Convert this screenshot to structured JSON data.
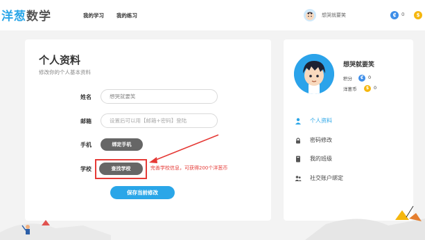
{
  "header": {
    "logo_part1": "洋葱",
    "logo_part2": "数学",
    "nav": [
      "我的学习",
      "我的练习"
    ],
    "username": "想哭就要笑",
    "coin1_value": "0"
  },
  "profile": {
    "title": "个人资料",
    "subtitle": "修改你的个人基本资料",
    "name_label": "姓名",
    "name_value": "想哭就要笑",
    "email_label": "邮箱",
    "email_placeholder": "设置后可以用【邮箱+密码】登陆",
    "phone_label": "手机",
    "phone_button": "绑定手机",
    "school_label": "学校",
    "school_button": "查找学校",
    "school_note": "完善学校信息，可获得200个洋葱币",
    "save_button": "保存当前修改"
  },
  "sidebar": {
    "name": "想哭就要笑",
    "points_label": "积分",
    "points_value": "0",
    "coins_label": "洋葱币",
    "coins_value": "0",
    "menu": [
      "个人资料",
      "密码修改",
      "我的班级",
      "社交账户绑定"
    ]
  },
  "colors": {
    "brand_blue": "#2aa6e8",
    "annotation_red": "#e53935",
    "coin_gold": "#f5b70f",
    "coin_blue": "#3e8ee8"
  },
  "icons": {
    "points": "blue-coin-icon",
    "coins": "gold-coin-icon",
    "menu": [
      "user-icon",
      "lock-icon",
      "class-icon",
      "social-icon"
    ]
  }
}
